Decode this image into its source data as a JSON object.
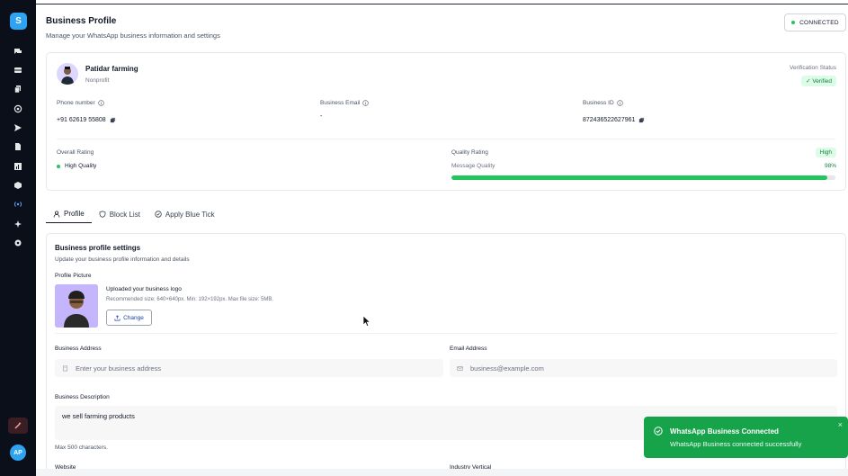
{
  "sidebar": {
    "logo_letter": "S",
    "items": [
      {
        "icon": "chat-icon"
      },
      {
        "icon": "inbox-icon"
      },
      {
        "icon": "copy-pages-icon"
      },
      {
        "icon": "at-icon"
      },
      {
        "icon": "send-icon"
      },
      {
        "icon": "file-icon"
      },
      {
        "icon": "chart-icon"
      },
      {
        "icon": "cube-icon"
      },
      {
        "icon": "broadcast-icon"
      },
      {
        "icon": "sparkles-icon"
      },
      {
        "icon": "gear-icon"
      }
    ],
    "avatar_initials": "AP",
    "accent": "#2ea3f2"
  },
  "header": {
    "title": "Business Profile",
    "subtitle": "Manage your WhatsApp business information and settings",
    "status_badge": "CONNECTED"
  },
  "business": {
    "name": "Patidar farming",
    "type": "Nonprofit",
    "verification_label": "Verification Status",
    "verification_value": "✓ Verified",
    "phone_label": "Phone number",
    "phone_value": "+91 62619 55808",
    "email_label": "Business Email",
    "email_value": "-",
    "id_label": "Business ID",
    "id_value": "872436522627961",
    "overall_rating_label": "Overall Rating",
    "overall_rating_value": "High Quality",
    "quality_rating_label": "Quality Rating",
    "quality_rating_badge": "High",
    "message_quality_label": "Message Quality",
    "message_quality_value": "98%",
    "message_quality_fraction": 0.98
  },
  "tabs": [
    {
      "label": "Profile",
      "icon": "user-icon",
      "active": true
    },
    {
      "label": "Block List",
      "icon": "shield-icon",
      "active": false
    },
    {
      "label": "Apply Blue Tick",
      "icon": "check-circle-icon",
      "active": false
    }
  ],
  "settings": {
    "title": "Business profile settings",
    "description": "Update your business profile information and details",
    "profile_picture_label": "Profile Picture",
    "upload_title": "Uploaded your business logo",
    "upload_hint": "Recommended size: 640×640px. Min: 192×192px. Max file size: 5MB.",
    "change_button": "Change",
    "address_label": "Business Address",
    "address_placeholder": "Enter your business address",
    "email_label": "Email Address",
    "email_placeholder": "business@example.com",
    "description_label": "Business Description",
    "description_value": "we sell farming products",
    "description_hint": "Max 500 characters.",
    "website_label": "Website",
    "industry_label": "Industry Vertical"
  },
  "toast": {
    "title": "WhatsApp Business Connected",
    "message": "WhatsApp Business connected successfully",
    "close": "×",
    "color": "#16a34a"
  }
}
